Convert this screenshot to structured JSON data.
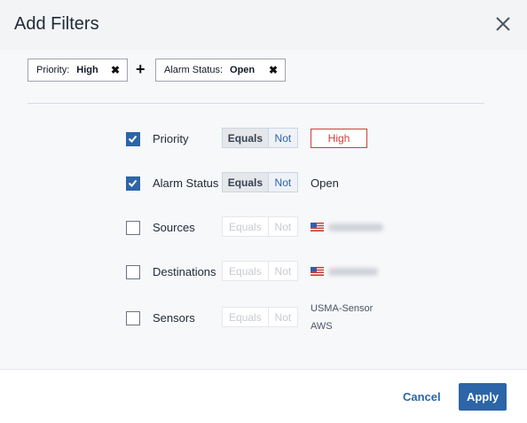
{
  "dialog": {
    "title": "Add Filters",
    "close_icon": "close-icon"
  },
  "chips": [
    {
      "key": "Priority:",
      "value": "High",
      "remove_icon": "✖"
    },
    {
      "key": "Alarm Status:",
      "value": "Open",
      "remove_icon": "✖"
    }
  ],
  "chips_separator": "+",
  "filters": [
    {
      "label": "Priority",
      "checked": true,
      "equals_label": "Equals",
      "not_label": "Not",
      "value": "High",
      "value_style": "red-outlined-box"
    },
    {
      "label": "Alarm Status",
      "checked": true,
      "equals_label": "Equals",
      "not_label": "Not",
      "value": "Open"
    },
    {
      "label": "Sources",
      "checked": false,
      "equals_label": "Equals",
      "not_label": "Not",
      "value_icon": "us-flag-icon"
    },
    {
      "label": "Destinations",
      "checked": false,
      "equals_label": "Equals",
      "not_label": "Not",
      "value_icon": "us-flag-icon"
    },
    {
      "label": "Sensors",
      "checked": false,
      "equals_label": "Equals",
      "not_label": "Not",
      "value_lines": [
        "USMA-Sensor",
        "AWS"
      ]
    }
  ],
  "footer": {
    "cancel_label": "Cancel",
    "apply_label": "Apply"
  },
  "colors": {
    "accent": "#2c65a8",
    "error": "#d63b3b",
    "header_bg": "#f3f4f6",
    "body_bg": "#f7f8fa"
  }
}
